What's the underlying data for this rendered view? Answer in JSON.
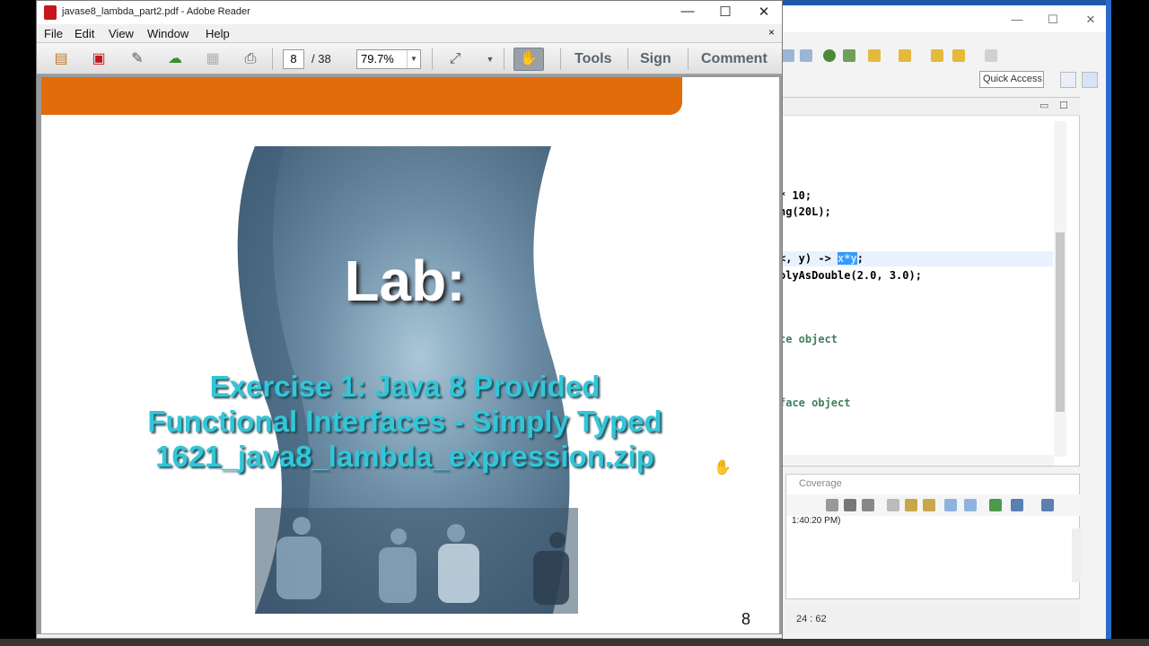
{
  "reader": {
    "title": "javase8_lambda_part2.pdf - Adobe Reader",
    "menu": [
      "File",
      "Edit",
      "View",
      "Window",
      "Help"
    ],
    "menu_close": "×",
    "current_page": "8",
    "page_count": "/ 38",
    "zoom": "79.7%",
    "tools_label": "Tools",
    "sign_label": "Sign",
    "comment_label": "Comment",
    "win_minimize": "—",
    "win_maximize": "☐",
    "win_close": "✕"
  },
  "slide": {
    "title": "Lab:",
    "line1": "Exercise 1: Java 8 Provided",
    "line2": "Functional Interfaces - Simply Typed",
    "line3": "1621_java8_lambda_expression.zip",
    "page_number": "8",
    "colors": {
      "banner": "#e06c0a",
      "subtitle": "#32c6d8",
      "blob": "#5b7d96"
    }
  },
  "eclipse": {
    "quick_access": "Quick Access",
    "code": {
      "l1": "* 10;",
      "l2": "ng(20L);",
      "l3_pre": "<, y) -> ",
      "l3_sel": "x*y",
      "l3_post": ";",
      "l4": "olyAsDouble(2.0, 3.0);",
      "l5": "ce object",
      "l6": "face object"
    },
    "console_tab": "Coverage",
    "console_text": "1:40:20 PM)",
    "status_position": "24 : 62"
  }
}
